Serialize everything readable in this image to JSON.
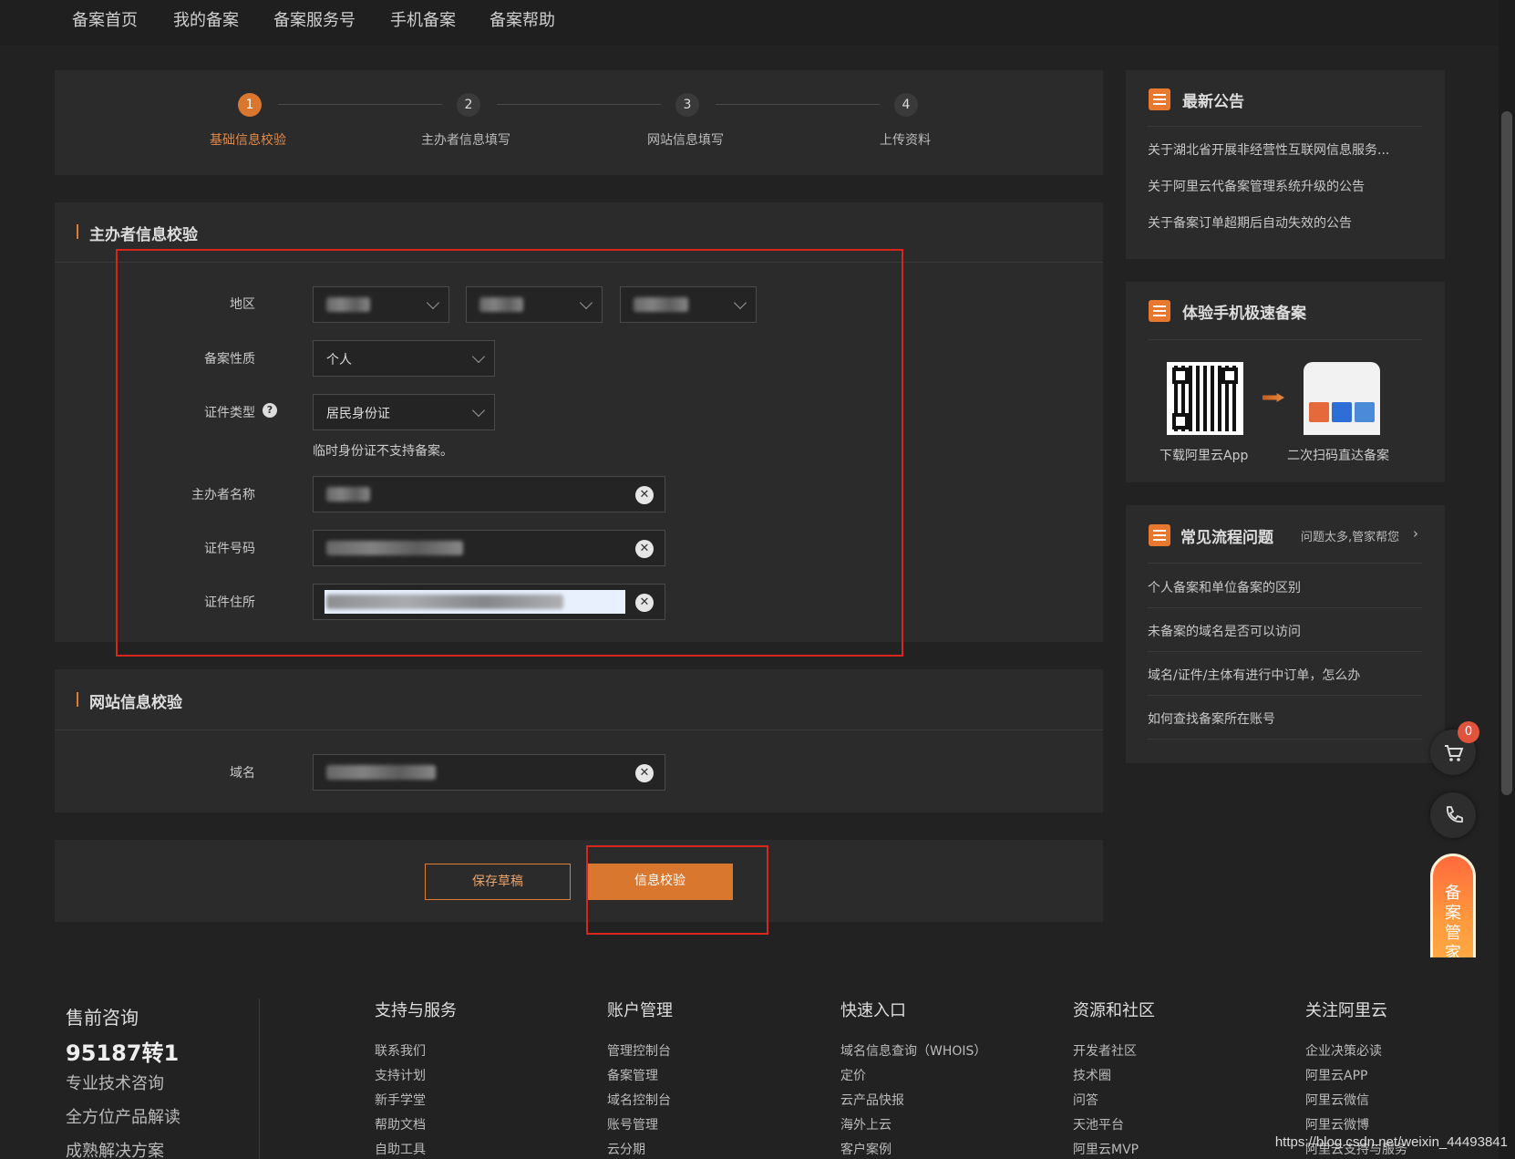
{
  "nav": [
    "备案首页",
    "我的备案",
    "备案服务号",
    "手机备案",
    "备案帮助"
  ],
  "steps": [
    {
      "num": "1",
      "label": "基础信息校验"
    },
    {
      "num": "2",
      "label": "主办者信息填写"
    },
    {
      "num": "3",
      "label": "网站信息填写"
    },
    {
      "num": "4",
      "label": "上传资料"
    }
  ],
  "sponsor_section": {
    "title": "主办者信息校验",
    "region_label": "地区",
    "nature_label": "备案性质",
    "nature_value": "个人",
    "id_type_label": "证件类型",
    "id_type_value": "居民身份证",
    "id_hint": "临时身份证不支持备案。",
    "name_label": "主办者名称",
    "id_number_label": "证件号码",
    "address_label": "证件住所"
  },
  "site_section": {
    "title": "网站信息校验",
    "domain_label": "域名"
  },
  "actions": {
    "save_draft": "保存草稿",
    "verify": "信息校验"
  },
  "sidebar": {
    "notice_title": "最新公告",
    "notices": [
      "关于湖北省开展非经营性互联网信息服务...",
      "关于阿里云代备案管理系统升级的公告",
      "关于备案订单超期后自动失效的公告"
    ],
    "mobile_title": "体验手机极速备案",
    "mobile_caption_left": "下载阿里云App",
    "mobile_caption_right": "二次扫码直达备案",
    "faq_title": "常见流程问题",
    "faq_sub": "问题太多,管家帮您",
    "faqs": [
      "个人备案和单位备案的区别",
      "未备案的域名是否可以访问",
      "域名/证件/主体有进行中订单，怎么办",
      "如何查找备案所在账号"
    ]
  },
  "floating": {
    "cart_count": "0",
    "manager": [
      "备",
      "案",
      "管",
      "家"
    ]
  },
  "footer": {
    "consult_title": "售前咨询",
    "phone": "95187转1",
    "lines": [
      "专业技术咨询",
      "全方位产品解读",
      "成熟解决方案"
    ],
    "columns": [
      {
        "head": "支持与服务",
        "links": [
          "联系我们",
          "支持计划",
          "新手学堂",
          "帮助文档",
          "自助工具"
        ]
      },
      {
        "head": "账户管理",
        "links": [
          "管理控制台",
          "备案管理",
          "域名控制台",
          "账号管理",
          "云分期"
        ]
      },
      {
        "head": "快速入口",
        "links": [
          "域名信息查询（WHOIS）",
          "定价",
          "云产品快报",
          "海外上云",
          "客户案例"
        ]
      },
      {
        "head": "资源和社区",
        "links": [
          "开发者社区",
          "技术圈",
          "问答",
          "天池平台",
          "阿里云MVP"
        ]
      },
      {
        "head": "关注阿里云",
        "links": [
          "企业决策必读",
          "阿里云APP",
          "阿里云微信",
          "阿里云微博",
          "阿里云支持与服务"
        ]
      }
    ],
    "watermark": "https://blog.csdn.net/weixin_44493841"
  }
}
